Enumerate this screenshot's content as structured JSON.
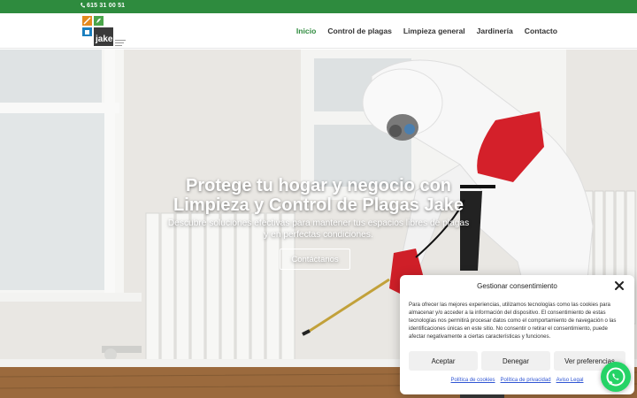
{
  "topbar": {
    "phone": "615 31 00 51",
    "phone_icon": "phone-icon"
  },
  "header": {
    "logo_icon": "jake-logo",
    "logo_text": "jake",
    "nav": [
      {
        "label": "Inicio",
        "active": true
      },
      {
        "label": "Control de plagas",
        "active": false
      },
      {
        "label": "Limpieza general",
        "active": false
      },
      {
        "label": "Jardinería",
        "active": false
      },
      {
        "label": "Contacto",
        "active": false
      }
    ]
  },
  "hero": {
    "title_line1": "Protege tu hogar y negocio con",
    "title_line2": "Limpieza y Control de Plagas Jake",
    "subtitle_line1": "Descubre soluciones efectivas para mantener tus espacios libres de plagas",
    "subtitle_line2": "y en perfectas condiciones.",
    "button_label": "Contáctanos"
  },
  "cookie_dialog": {
    "title": "Gestionar consentimiento",
    "close_icon": "close-icon",
    "text": "Para ofrecer las mejores experiencias, utilizamos tecnologías como las cookies para almacenar y/o acceder a la información del dispositivo. El consentimiento de estas tecnologías nos permitirá procesar datos como el comportamiento de navegación o las identificaciones únicas en este sitio. No consentir o retirar el consentimiento, puede afectar negativamente a ciertas características y funciones.",
    "buttons": {
      "accept": "Aceptar",
      "deny": "Denegar",
      "preferences": "Ver preferencias"
    },
    "links": {
      "cookies": "Política de cookies",
      "privacy": "Política de privacidad",
      "legal": "Aviso Legal"
    }
  },
  "whatsapp": {
    "icon": "whatsapp-icon"
  },
  "colors": {
    "brand_green": "#2e8b3e",
    "link_blue": "#2f55d4",
    "glove_red": "#d4202a",
    "whatsapp": "#25d366"
  }
}
